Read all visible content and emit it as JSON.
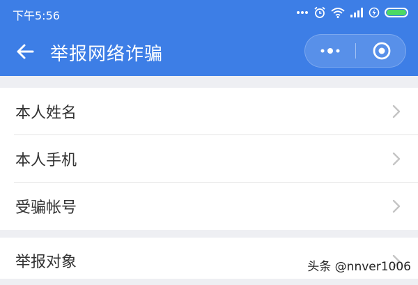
{
  "status_bar": {
    "time": "下午5:56",
    "icons": [
      "more-dots-icon",
      "alarm-icon",
      "wifi-icon",
      "signal-icon",
      "charging-icon",
      "battery-icon"
    ]
  },
  "navbar": {
    "title": "举报网络诈骗",
    "back_icon": "back-arrow-icon",
    "capsule_icons": [
      "more-icon",
      "close-target-icon"
    ]
  },
  "groups": [
    {
      "items": [
        {
          "label": "本人姓名",
          "icon": "chevron-right-icon"
        },
        {
          "label": "本人手机",
          "icon": "chevron-right-icon"
        },
        {
          "label": "受骗帐号",
          "icon": "chevron-right-icon"
        }
      ]
    },
    {
      "items": [
        {
          "label": "举报对象",
          "icon": "chevron-right-icon"
        }
      ]
    }
  ],
  "watermark": "头条 @nnver1006",
  "colors": {
    "header": "#3d7ee6",
    "background": "#eeeff3",
    "battery": "#4cd964"
  }
}
